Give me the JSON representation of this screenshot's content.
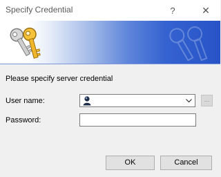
{
  "window": {
    "title": "Specify Credential",
    "help_glyph": "?",
    "close_glyph": "✕"
  },
  "banner": {
    "icon": "keys-icon",
    "watermark_icon": "keys-watermark-icon",
    "gradient_start": "#ffffff",
    "gradient_end": "#2753c7"
  },
  "content": {
    "instruction": "Please specify server credential"
  },
  "form": {
    "username_label": "User name:",
    "username_value": "",
    "browse_label": "...",
    "password_label": "Password:",
    "password_value": ""
  },
  "buttons": {
    "ok": "OK",
    "cancel": "Cancel"
  }
}
